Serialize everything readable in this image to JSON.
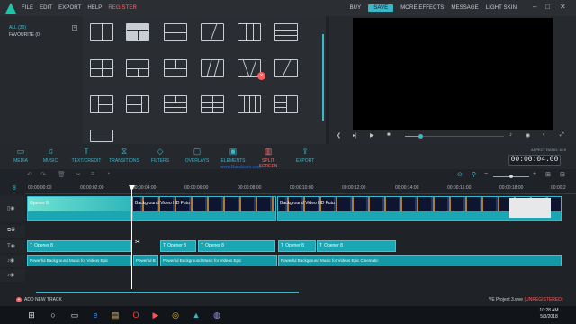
{
  "menubar": {
    "items": [
      "FILE",
      "EDIT",
      "EXPORT",
      "HELP",
      "REGISTER"
    ],
    "right_items": [
      "BUY",
      "SAVE",
      "MORE EFFECTS",
      "MESSAGE",
      "LIGHT SKIN"
    ]
  },
  "library": {
    "items": [
      "ALL (30)",
      "FAVOURITE (0)"
    ],
    "add": "+"
  },
  "preview": {
    "aspect_ratio": "ASPECT RATIO: 16:9",
    "timecode": "00:00:04.00",
    "playback_progress_percent": 15
  },
  "toolbar": {
    "items": [
      "MEDIA",
      "MUSIC",
      "TEXT/CREDIT",
      "TRANSITIONS",
      "FILTERS",
      "OVERLAYS",
      "ELEMENTS",
      "SPLIT SCREEN",
      "EXPORT"
    ],
    "active": "SPLIT SCREEN"
  },
  "watermark": "www.Bandicam.com",
  "ruler": {
    "marks": [
      "00:00:00:00",
      "00:00:02:00",
      "00:00:04:00",
      "00:00:06:00",
      "00:00:08:00",
      "00:00:10:00",
      "00:00:12:00",
      "00:00:14:00",
      "00:00:16:00",
      "00:00:18:00",
      "00:00:2"
    ]
  },
  "timeline": {
    "video_clips": [
      "Opener 8",
      "Background Video HD Futu",
      "Background Video HD Futu"
    ],
    "text_clips": [
      "Opener 8",
      "Opener 8",
      "Opener 8",
      "Opener 8",
      "Opener 8"
    ],
    "audio_clips": [
      "Powerful Background Music for Videos Epic",
      "Powerful B",
      "Powerful Background Music for Videos Epic",
      "Powerful Background Music for Videos Epic Cinematic"
    ],
    "cut_mark": "✂"
  },
  "status": {
    "add_track": "ADD NEW TRACK",
    "project": "VE Project 3.wve",
    "unregistered": "(UNREGISTERED)"
  },
  "taskbar": {
    "time": "10:28 AM",
    "date": "5/3/2018"
  }
}
